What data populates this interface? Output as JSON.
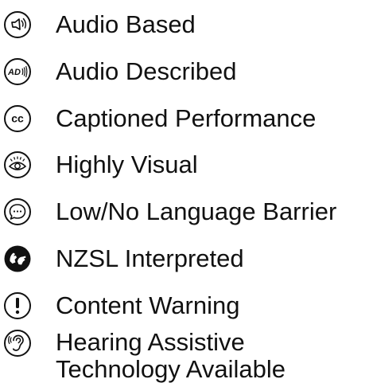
{
  "legend": {
    "items": [
      {
        "label": "Audio Based",
        "icon": "audio-based-icon"
      },
      {
        "label": "Audio Described",
        "icon": "audio-described-icon"
      },
      {
        "label": "Captioned Performance",
        "icon": "captioned-icon"
      },
      {
        "label": "Highly Visual",
        "icon": "eye-icon"
      },
      {
        "label": "Low/No Language Barrier",
        "icon": "speech-bubble-icon"
      },
      {
        "label": "NZSL Interpreted",
        "icon": "sign-language-icon"
      },
      {
        "label": "Content Warning",
        "icon": "exclamation-icon"
      },
      {
        "label": "Hearing Assistive Technology Available",
        "icon": "ear-icon"
      }
    ],
    "icon_text": {
      "ad": "AD",
      "cc": "cc"
    }
  }
}
